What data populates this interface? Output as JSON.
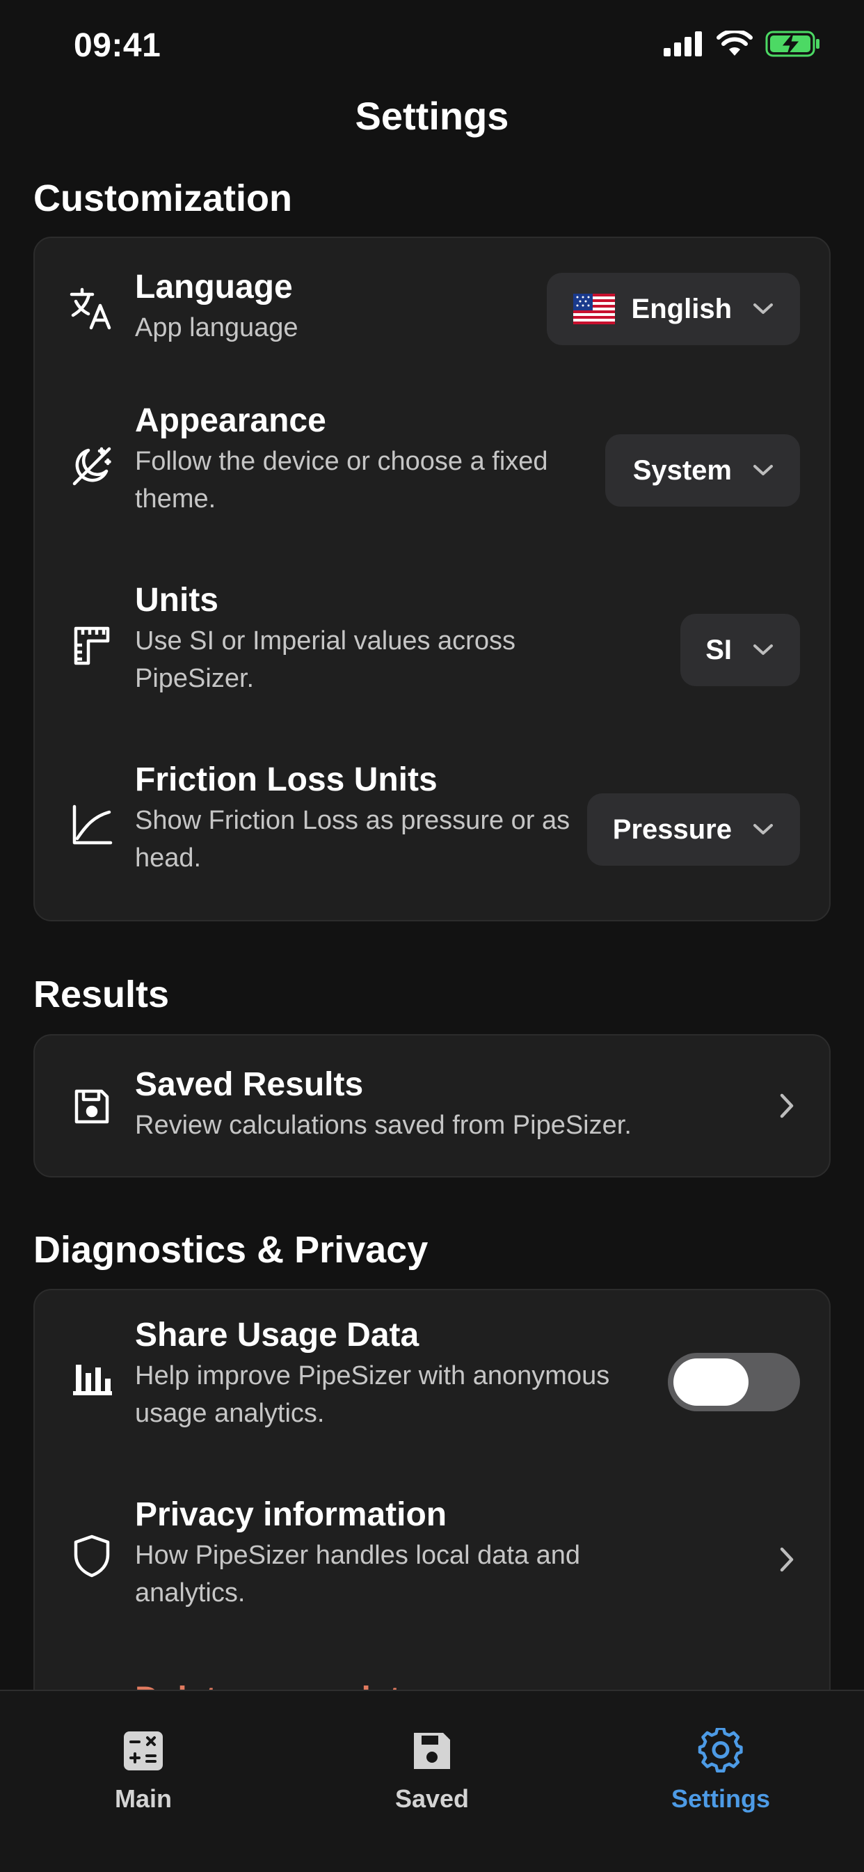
{
  "status_bar": {
    "time": "09:41"
  },
  "nav": {
    "title": "Settings"
  },
  "sections": {
    "customization": {
      "title": "Customization",
      "language": {
        "title": "Language",
        "subtitle": "App language",
        "value": "English",
        "flag": "us-flag"
      },
      "appearance": {
        "title": "Appearance",
        "subtitle": "Follow the device or choose a fixed theme.",
        "value": "System"
      },
      "units": {
        "title": "Units",
        "subtitle": "Use SI or Imperial values across PipeSizer.",
        "value": "SI"
      },
      "friction": {
        "title": "Friction Loss Units",
        "subtitle": "Show Friction Loss as pressure or as head.",
        "value": "Pressure"
      }
    },
    "results": {
      "title": "Results",
      "saved": {
        "title": "Saved Results",
        "subtitle": "Review calculations saved from PipeSizer."
      }
    },
    "diagnostics": {
      "title": "Diagnostics & Privacy",
      "share": {
        "title": "Share Usage Data",
        "subtitle": "Help improve PipeSizer with anonymous usage analytics.",
        "enabled": false
      },
      "privacy": {
        "title": "Privacy information",
        "subtitle": "How PipeSizer handles local data and analytics."
      },
      "delete": {
        "title": "Delete usage data"
      }
    }
  },
  "tab_bar": {
    "tabs": [
      {
        "label": "Main",
        "icon": "calculator-icon",
        "active": false
      },
      {
        "label": "Saved",
        "icon": "floppy-disk-icon",
        "active": false
      },
      {
        "label": "Settings",
        "icon": "gear-icon",
        "active": true
      }
    ]
  },
  "colors": {
    "background": "#121212",
    "card": "#1f1f1f",
    "accent": "#4d9be6",
    "destructive": "#e07a5f",
    "battery": "#4cd964"
  }
}
